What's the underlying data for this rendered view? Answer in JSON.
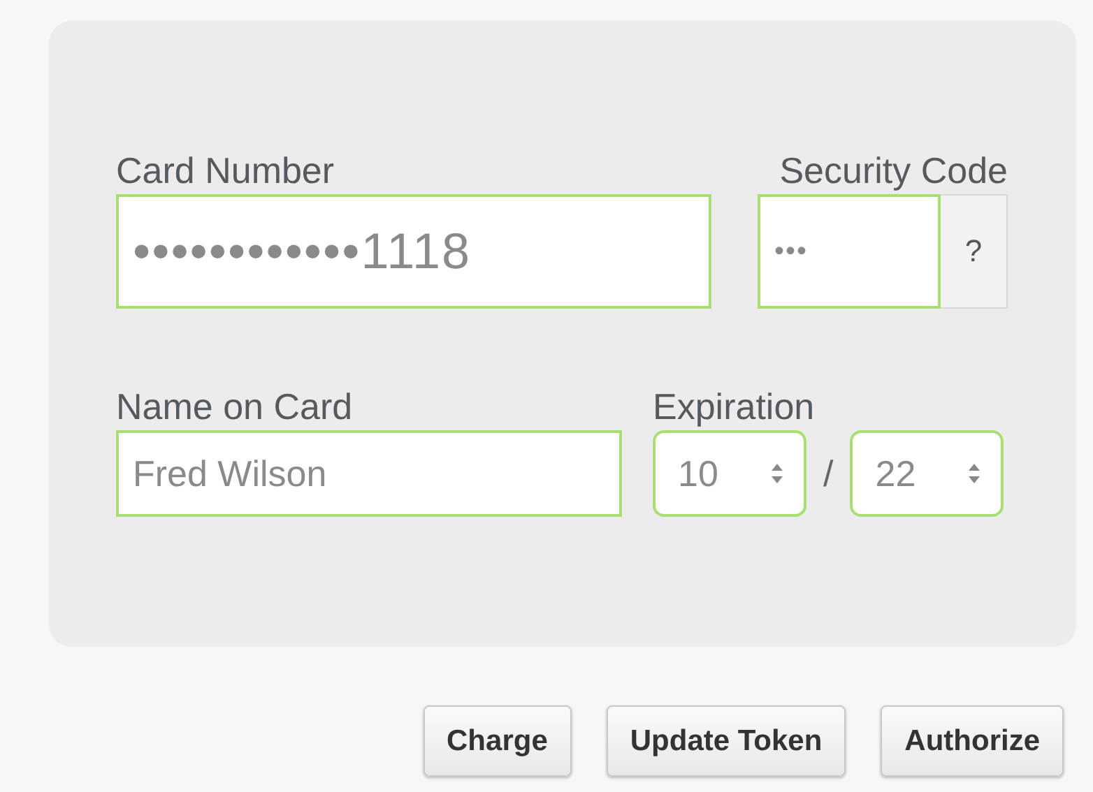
{
  "card_number": {
    "label": "Card Number",
    "value": "••••••••••••1118"
  },
  "security_code": {
    "label": "Security Code",
    "value": "•••",
    "help": "?"
  },
  "name_on_card": {
    "label": "Name on Card",
    "value": "Fred Wilson"
  },
  "expiration": {
    "label": "Expiration",
    "month": "10",
    "separator": "/",
    "year": "22"
  },
  "buttons": [
    "Charge",
    "Update Token",
    "Authorize"
  ]
}
